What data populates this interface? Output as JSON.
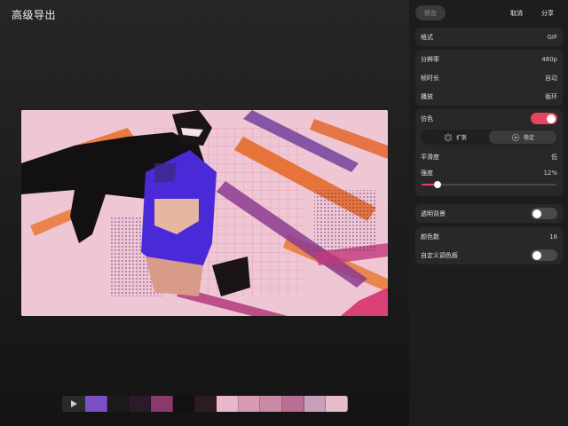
{
  "header": {
    "title": "高级导出"
  },
  "timeline": {
    "frame_colors": [
      "#7b4fc7",
      "#1a1a1a",
      "#2a1a2a",
      "#8a3a6a",
      "#111111",
      "#2b1b22",
      "#e9b6cc",
      "#d79bb5",
      "#c98aa6",
      "#b96f95",
      "#caa0b8",
      "#e7bccd"
    ]
  },
  "toolbar": {
    "preview_label": "预览",
    "cancel_label": "取消",
    "share_label": "分享"
  },
  "format": {
    "label": "格式",
    "value": "GIF"
  },
  "settings": {
    "resolution": {
      "label": "分辨率",
      "value": "480p"
    },
    "duration": {
      "label": "帧时长",
      "value": "自动"
    },
    "playback": {
      "label": "播放",
      "value": "循环"
    }
  },
  "dither": {
    "label": "仿色",
    "enabled": true,
    "modes": [
      {
        "label": "扩散",
        "icon": "diffusion-icon",
        "active": false
      },
      {
        "label": "稳定",
        "icon": "stable-icon",
        "active": true
      }
    ],
    "smoothness": {
      "label": "平滑度",
      "value": "低"
    },
    "strength": {
      "label": "强度",
      "value": "12%",
      "fraction": 0.12
    }
  },
  "transparent_bg": {
    "label": "透明背景",
    "enabled": false
  },
  "palette": {
    "colors_count": {
      "label": "颜色数",
      "value": "16"
    },
    "custom_palette": {
      "label": "自定义调色板",
      "enabled": false
    }
  },
  "colors": {
    "accent": "#e8435f",
    "panel": "#282828",
    "background": "#161616"
  }
}
